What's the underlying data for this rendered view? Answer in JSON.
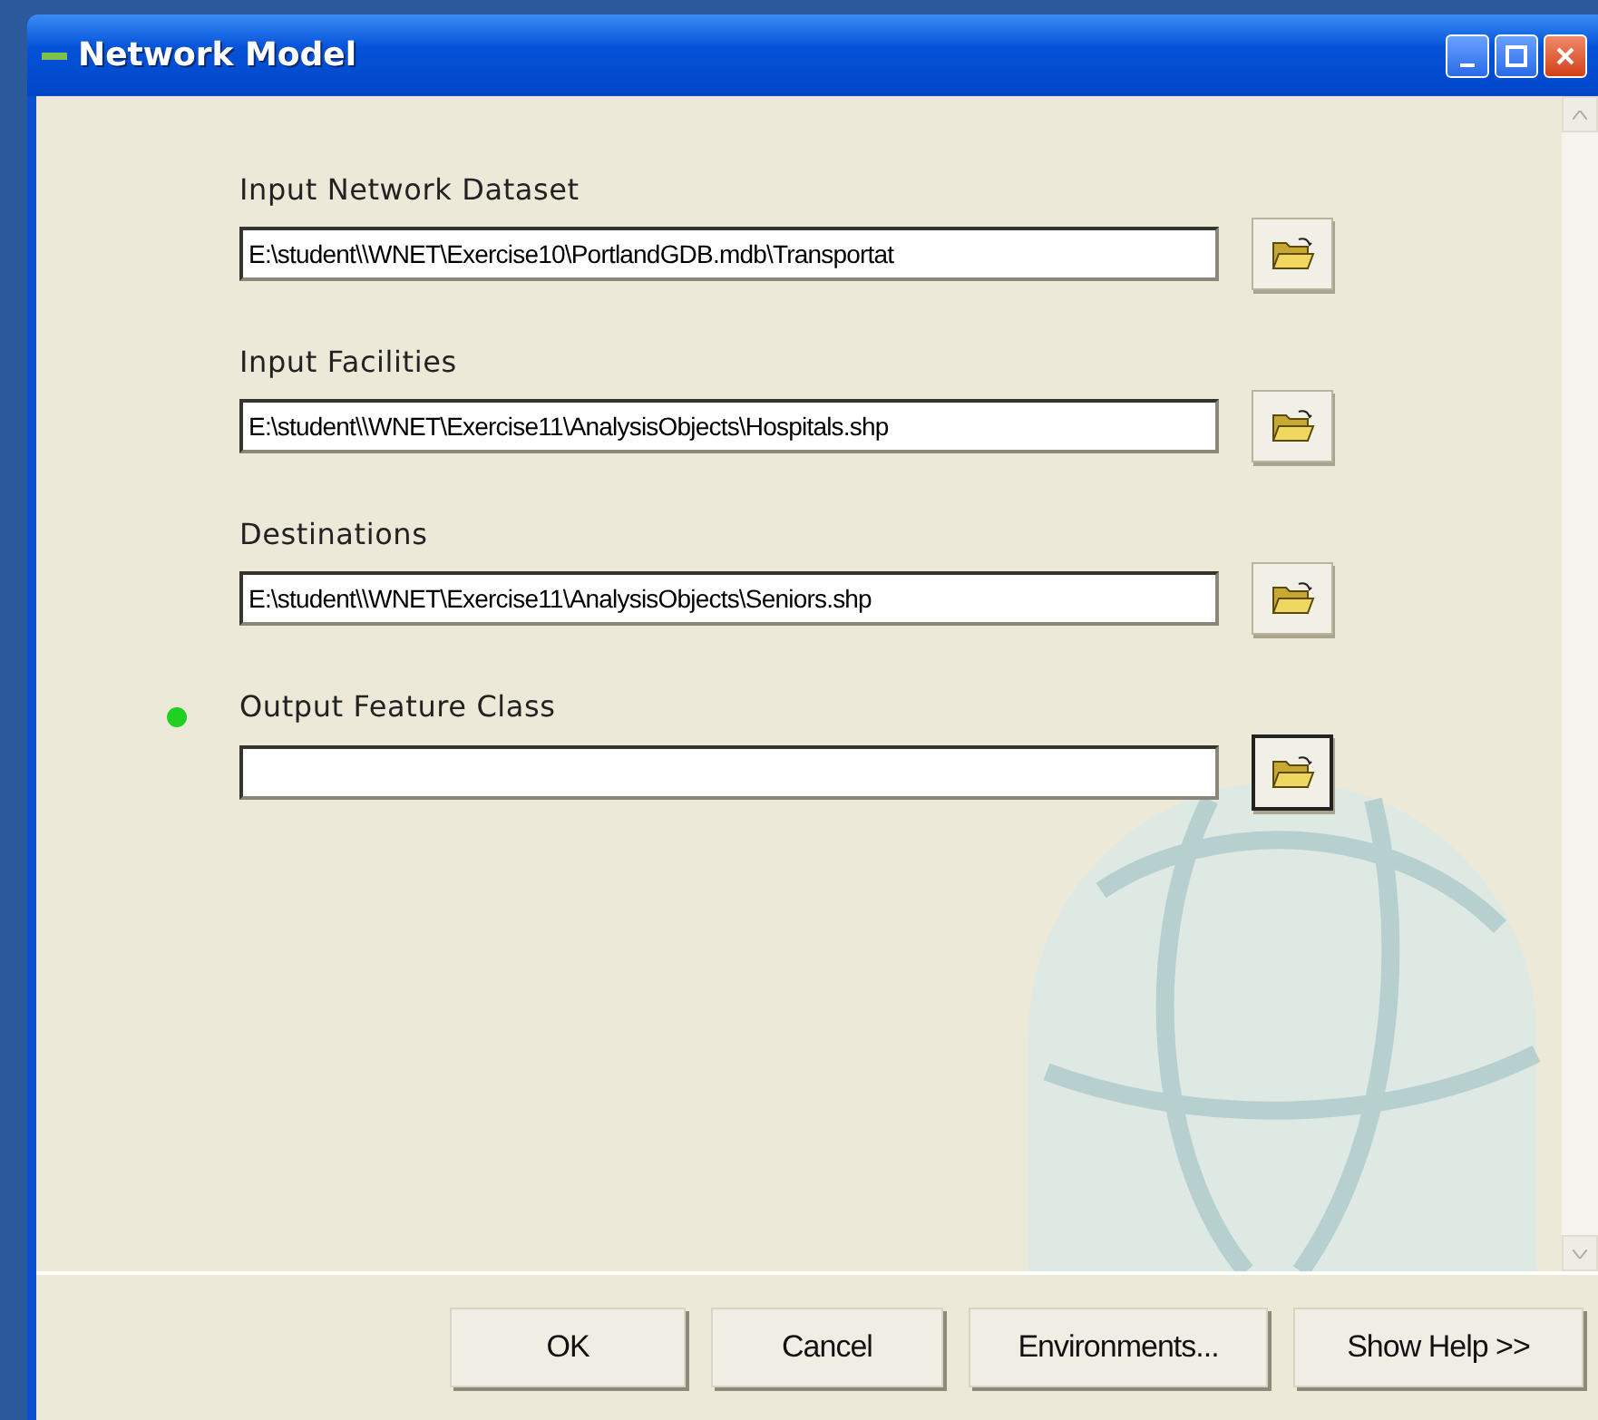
{
  "window": {
    "title": "Network Model"
  },
  "parameters": [
    {
      "label": "Input Network Dataset",
      "value": "E:\\student\\\\WNET\\Exercise10\\PortlandGDB.mdb\\Transportat",
      "required": false,
      "focused": false
    },
    {
      "label": "Input Facilities",
      "value": "E:\\student\\\\WNET\\Exercise11\\AnalysisObjects\\Hospitals.shp",
      "required": false,
      "focused": false
    },
    {
      "label": "Destinations",
      "value": "E:\\student\\\\WNET\\Exercise11\\AnalysisObjects\\Seniors.shp",
      "required": false,
      "focused": false
    },
    {
      "label": "Output Feature Class",
      "required": true,
      "focused": true
    }
  ],
  "buttons": [
    "OK",
    "Cancel",
    "Environments...",
    "Show Help >>"
  ]
}
